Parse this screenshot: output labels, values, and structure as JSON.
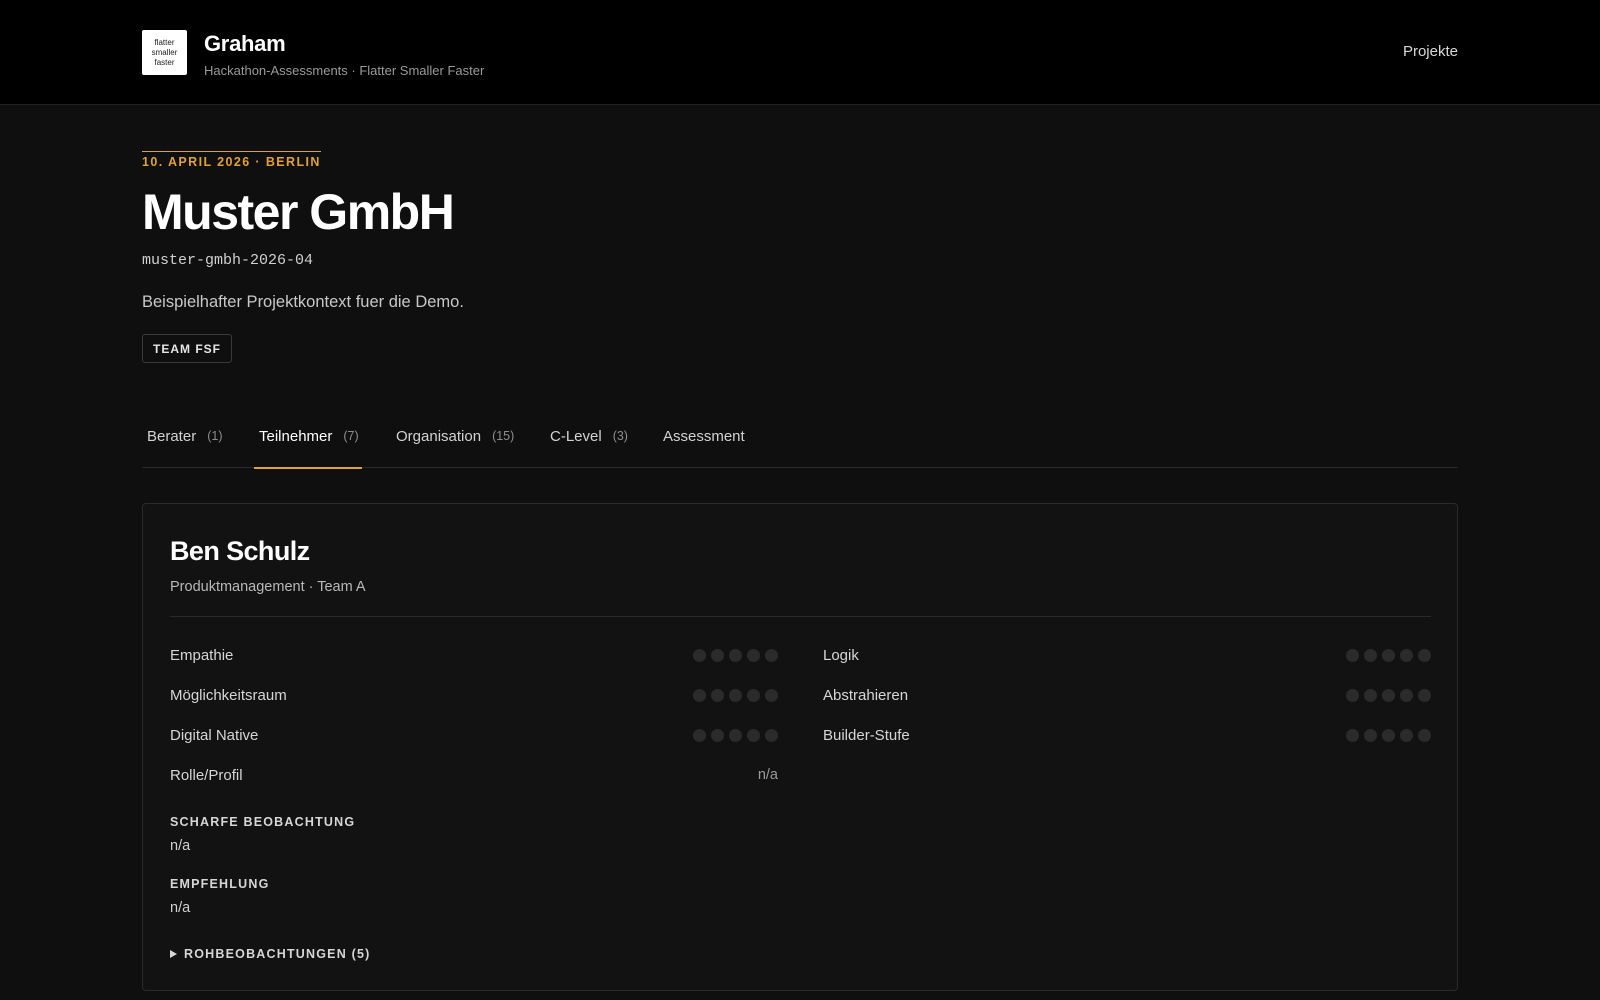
{
  "header": {
    "logo_lines": [
      "flatter",
      "smaller",
      "faster"
    ],
    "brand_title": "Graham",
    "brand_subtitle": "Hackathon-Assessments · Flatter Smaller Faster",
    "nav_projects": "Projekte"
  },
  "project": {
    "eyebrow": "10. APRIL 2026 · BERLIN",
    "company": "Muster GmbH",
    "slug": "muster-gmbh-2026-04",
    "context": "Beispielhafter Projektkontext fuer die Demo.",
    "team_badge": "TEAM FSF"
  },
  "tabs": [
    {
      "label": "Berater",
      "count": "(1)"
    },
    {
      "label": "Teilnehmer",
      "count": "(7)",
      "active": true
    },
    {
      "label": "Organisation",
      "count": "(15)"
    },
    {
      "label": "C-Level",
      "count": "(3)"
    },
    {
      "label": "Assessment",
      "count": ""
    }
  ],
  "participant": {
    "name": "Ben Schulz",
    "role": "Produktmanagement · Team A",
    "metrics_left": [
      {
        "label": "Empathie",
        "rating": 0,
        "max": 5
      },
      {
        "label": "Möglichkeitsraum",
        "rating": 0,
        "max": 5
      },
      {
        "label": "Digital Native",
        "rating": 0,
        "max": 5
      },
      {
        "label": "Rolle/Profil",
        "value": "n/a"
      }
    ],
    "metrics_right": [
      {
        "label": "Logik",
        "rating": 0,
        "max": 5
      },
      {
        "label": "Abstrahieren",
        "rating": 0,
        "max": 5
      },
      {
        "label": "Builder-Stufe",
        "rating": 0,
        "max": 5
      }
    ],
    "sharp_observation_label": "SCHARFE BEOBACHTUNG",
    "sharp_observation_value": "n/a",
    "recommendation_label": "EMPFEHLUNG",
    "recommendation_value": "n/a",
    "raw_observations_label": "ROHBEOBACHTUNGEN (5)"
  },
  "colors": {
    "accent": "#e0a234",
    "background": "#0f0f0f",
    "header": "#000000",
    "dot_empty": "#2b2b2b"
  }
}
